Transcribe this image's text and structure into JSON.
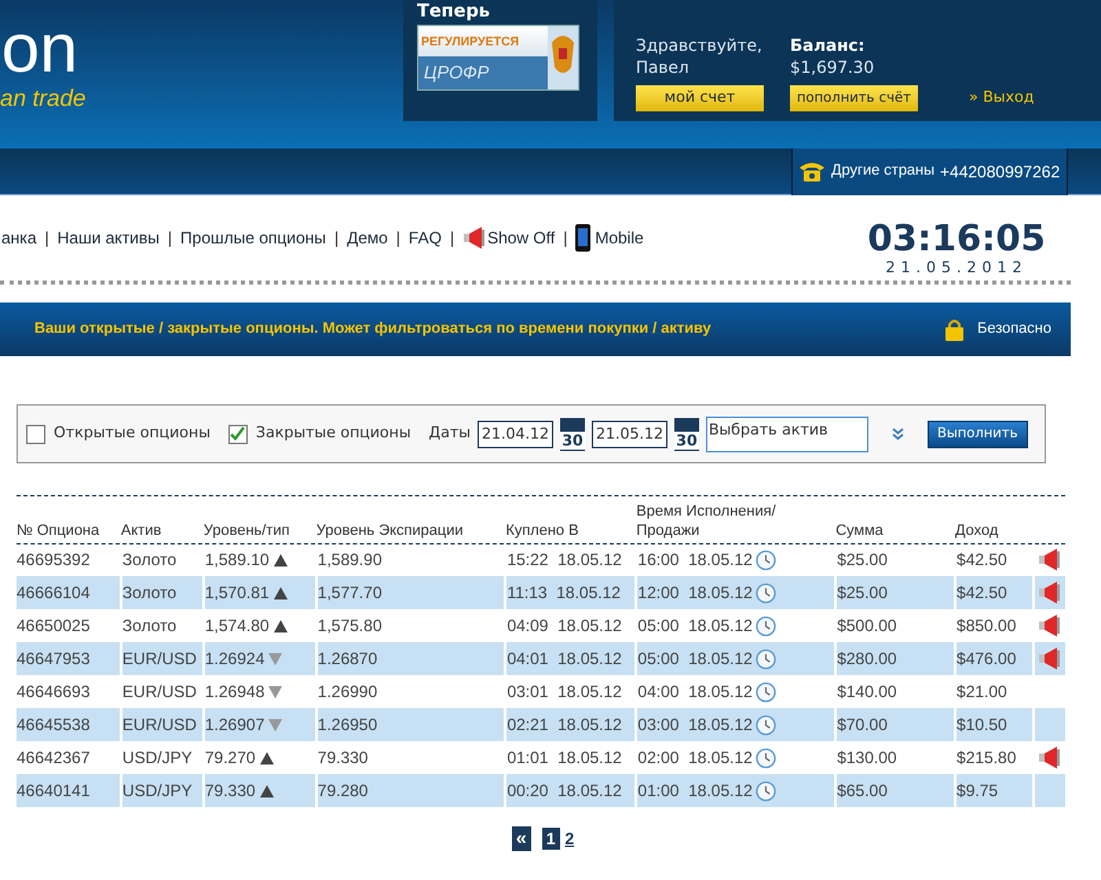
{
  "header": {
    "logo": "on",
    "slogan": "an trade",
    "promo_title": "Теперь",
    "badge_top": "РЕГУЛИРУЕТСЯ",
    "badge_bottom": "ЦРОФР",
    "greeting": "Здравствуйте,",
    "user": "Павел",
    "balance_label": "Баланс:",
    "balance": "$1,697.30",
    "account_button": "мой счет",
    "deposit_button": "пополнить счёт",
    "logout": "» Выход",
    "phone_label": "Другие страны",
    "phone": "+442080997262"
  },
  "nav": {
    "items": [
      {
        "label": "анка",
        "kind": "plain"
      },
      {
        "separator": "|",
        "label": "Наши активы",
        "kind": "plain"
      },
      {
        "separator": "|",
        "label": "Прошлые опционы",
        "kind": "plain"
      },
      {
        "separator": "|",
        "label": "Демо",
        "kind": "plain"
      },
      {
        "separator": "|",
        "label": "FAQ",
        "kind": "plain"
      },
      {
        "separator": "|",
        "label": "Show Off",
        "kind": "megaphone"
      },
      {
        "separator": "|",
        "label": "Mobile",
        "kind": "mobile"
      }
    ],
    "time": "03:16:05",
    "date": "21.05.2012"
  },
  "banner": {
    "text": "Ваши открытые / закрытые опционы. Может фильтроваться по времени покупки / активу",
    "secure": "Безопасно"
  },
  "filter": {
    "checks": [
      {
        "label": "Открытые опционы",
        "checked": false
      },
      {
        "label": "Закрытые опционы",
        "checked": true
      }
    ],
    "dates_label": "Даты",
    "date_from": "21.04.12",
    "date_to": "21.05.12",
    "calendar_from": "30",
    "calendar_to": "30",
    "asset_value": "Выбрать актив",
    "submit": "Выполнить"
  },
  "table": {
    "columns": [
      "№ Опциона",
      "Актив",
      "Уровень/тип",
      "Уровень Экспирации",
      "Куплено В",
      "Время Исполнения/Продажи",
      "Сумма",
      "Доход"
    ],
    "rows": [
      {
        "id": "46695392",
        "asset": "Золото",
        "level": "1,589.10",
        "kind": "up",
        "expiry": "1,589.90",
        "bought": "15:22  18.05.12",
        "closed": "16:00  18.05.12",
        "amount": "$25.00",
        "income": "$42.50",
        "share": true
      },
      {
        "id": "46666104",
        "asset": "Золото",
        "level": "1,570.81",
        "kind": "up",
        "expiry": "1,577.70",
        "bought": "11:13  18.05.12",
        "closed": "12:00  18.05.12",
        "amount": "$25.00",
        "income": "$42.50",
        "share": true
      },
      {
        "id": "46650025",
        "asset": "Золото",
        "level": "1,574.80",
        "kind": "up",
        "expiry": "1,575.80",
        "bought": "04:09  18.05.12",
        "closed": "05:00  18.05.12",
        "amount": "$500.00",
        "income": "$850.00",
        "share": true
      },
      {
        "id": "46647953",
        "asset": "EUR/USD",
        "level": "1.26924",
        "kind": "down",
        "expiry": "1.26870",
        "bought": "04:01  18.05.12",
        "closed": "05:00  18.05.12",
        "amount": "$280.00",
        "income": "$476.00",
        "share": true
      },
      {
        "id": "46646693",
        "asset": "EUR/USD",
        "level": "1.26948",
        "kind": "down",
        "expiry": "1.26990",
        "bought": "03:01  18.05.12",
        "closed": "04:00  18.05.12",
        "amount": "$140.00",
        "income": "$21.00",
        "share": false
      },
      {
        "id": "46645538",
        "asset": "EUR/USD",
        "level": "1.26907",
        "kind": "down",
        "expiry": "1.26950",
        "bought": "02:21  18.05.12",
        "closed": "03:00  18.05.12",
        "amount": "$70.00",
        "income": "$10.50",
        "share": false
      },
      {
        "id": "46642367",
        "asset": "USD/JPY",
        "level": "79.270",
        "kind": "up",
        "expiry": "79.330",
        "bought": "01:01  18.05.12",
        "closed": "02:00  18.05.12",
        "amount": "$130.00",
        "income": "$215.80",
        "share": true
      },
      {
        "id": "46640141",
        "asset": "USD/JPY",
        "level": "79.330",
        "kind": "up",
        "expiry": "79.280",
        "bought": "00:20  18.05.12",
        "closed": "01:00  18.05.12",
        "amount": "$65.00",
        "income": "$9.75",
        "share": false
      }
    ]
  },
  "pagination": [
    {
      "label": "«",
      "kind": "prev"
    },
    {
      "label": "1",
      "kind": "page",
      "selected": true
    },
    {
      "label": "2",
      "kind": "page",
      "selected": false
    }
  ]
}
